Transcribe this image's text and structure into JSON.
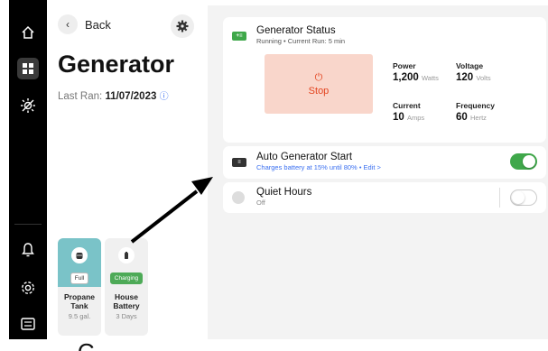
{
  "nav": {
    "items": [
      {
        "icon": "home-icon"
      },
      {
        "icon": "grid-icon"
      },
      {
        "icon": "sun-off-icon"
      }
    ],
    "bottom_items": [
      {
        "icon": "bell-icon"
      },
      {
        "icon": "settings-icon"
      },
      {
        "icon": "keyboard-icon"
      }
    ]
  },
  "header": {
    "back_label": "Back",
    "title": "Generator",
    "last_ran_label": "Last Ran:",
    "last_ran_value": "11/07/2023"
  },
  "tiles": [
    {
      "name": "Propane Tank",
      "badge": "Full",
      "value": "9.5 gal.",
      "color": "#7ac3c8"
    },
    {
      "name": "House Battery",
      "badge": "Charging",
      "value": "3 Days",
      "color": "#4daa57"
    }
  ],
  "generator_status": {
    "title": "Generator Status",
    "subtitle": "Running • Current Run: 5 min",
    "stop_label": "Stop",
    "stats": [
      {
        "label": "Power",
        "value": "1,200",
        "unit": "Watts"
      },
      {
        "label": "Voltage",
        "value": "120",
        "unit": "Volts"
      },
      {
        "label": "Current",
        "value": "10",
        "unit": "Amps"
      },
      {
        "label": "Frequency",
        "value": "60",
        "unit": "Hertz"
      }
    ]
  },
  "auto_start": {
    "title": "Auto Generator Start",
    "subtitle": "Charges battery at 15% until 80% • Edit >",
    "enabled": true
  },
  "quiet_hours": {
    "title": "Quiet Hours",
    "subtitle": "Off",
    "enabled": false
  },
  "bottom_text": "- C           -  -   -  -      -   -    -  -  -  -  -  -  -",
  "colors": {
    "accent": "#3a6ff0",
    "stop": "#e3441f",
    "stop_bg": "#f9d6cb",
    "toggle_on": "#3fa84a",
    "chip_green": "#3fa84a"
  }
}
